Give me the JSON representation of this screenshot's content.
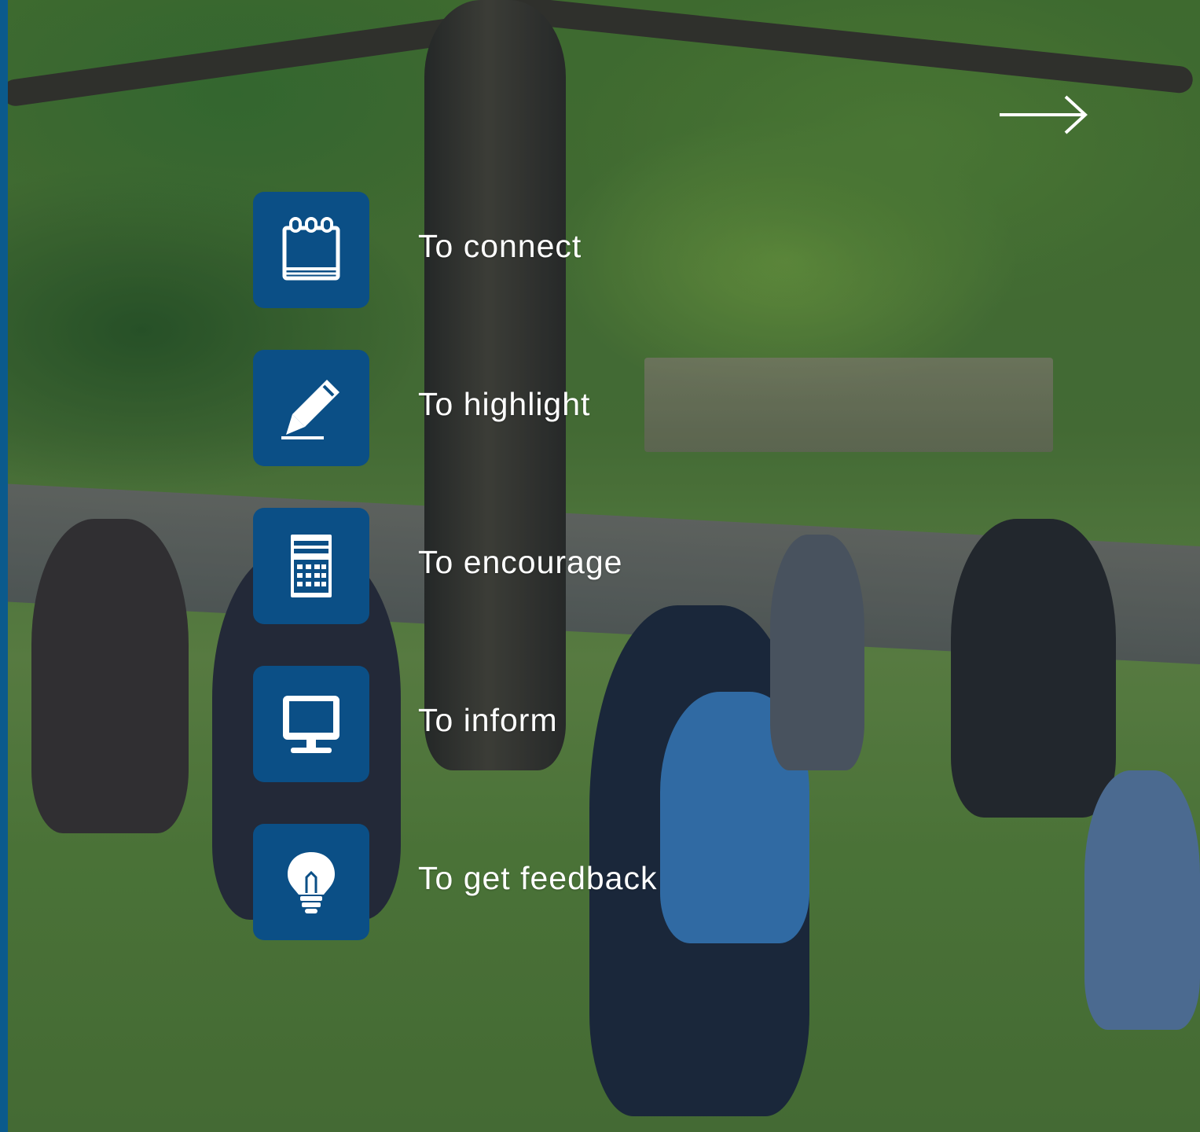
{
  "next_arrow": {
    "icon": "arrow-right-icon"
  },
  "items": [
    {
      "label": "To connect",
      "icon": "notepad-icon"
    },
    {
      "label": "To highlight",
      "icon": "pen-icon"
    },
    {
      "label": "To encourage",
      "icon": "calculator-icon"
    },
    {
      "label": "To inform",
      "icon": "monitor-icon"
    },
    {
      "label": "To get feedback",
      "icon": "lightbulb-icon"
    }
  ],
  "colors": {
    "tile": "#0b4f86",
    "accent_bar": "#0b5a8c",
    "text": "#ffffff"
  }
}
